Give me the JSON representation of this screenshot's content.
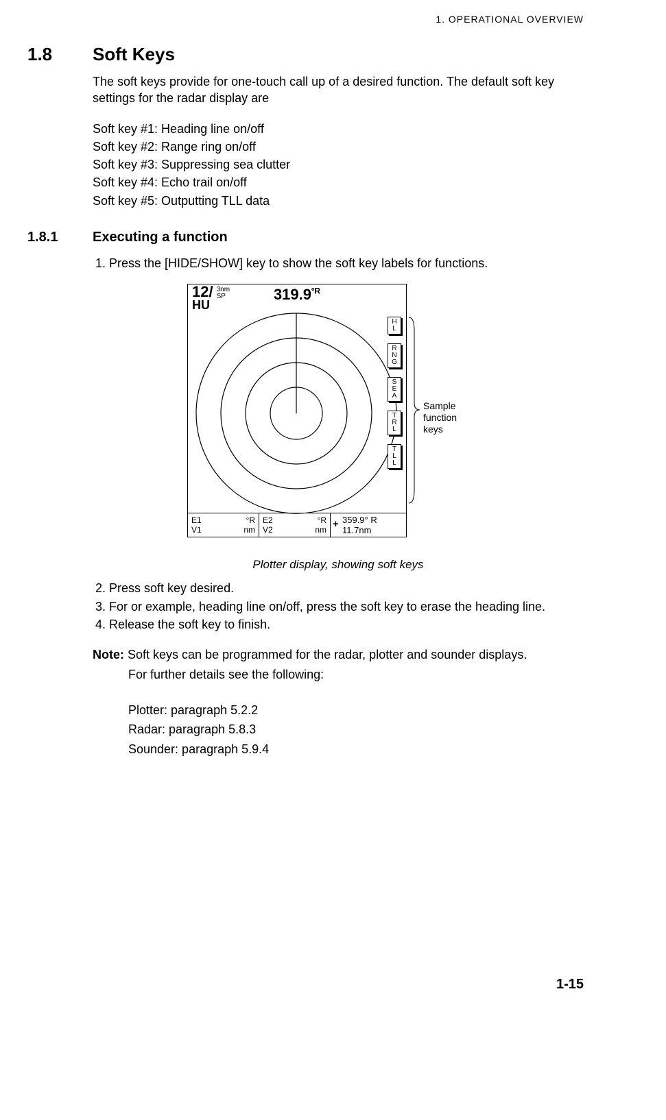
{
  "header": {
    "chapter": "1.   OPERATIONAL OVERVIEW"
  },
  "section": {
    "num": "1.8",
    "title": "Soft Keys"
  },
  "intro": "The soft keys provide for one-touch call up of a desired function. The default soft key settings for the radar display are",
  "softkey_defaults": [
    "Soft key #1: Heading line on/off",
    "Soft key #2: Range ring on/off",
    "Soft key #3: Suppressing sea clutter",
    "Soft key #4: Echo trail on/off",
    "Soft key #5: Outputting TLL data"
  ],
  "subsection": {
    "num": "1.8.1",
    "title": "Executing a function"
  },
  "steps_a": [
    "Press the [HIDE/SHOW] key to show the soft key labels for functions."
  ],
  "figure": {
    "range_main": "12",
    "range_sep": "/",
    "range_sub1": "3nm",
    "range_sub2": "SP",
    "hu": "HU",
    "bearing": "319.9",
    "bearing_unit": "ºR",
    "e1": "E1",
    "v1": "V1",
    "e1u": "°R",
    "v1u": "nm",
    "e2": "E2",
    "v2": "V2",
    "e2u": "°R",
    "v2u": "nm",
    "cursor_brg": "359.9°  R",
    "cursor_rng": "11.7nm",
    "keys": [
      "HL",
      "RNG",
      "SEA",
      "TRL",
      "TLL"
    ],
    "bracket_label1": "Sample function",
    "bracket_label2": "keys",
    "caption": "Plotter display, showing soft keys"
  },
  "steps_b": [
    "Press soft key desired.",
    "For or example, heading line on/off, press the soft key to erase the heading line.",
    "Release the soft key to finish."
  ],
  "note": {
    "label": "Note:",
    "line1": " Soft keys can be programmed for the radar, plotter and sounder displays. ",
    "line2": "For further details see the following:",
    "refs": [
      "Plotter: paragraph 5.2.2",
      "Radar: paragraph 5.8.3",
      "Sounder: paragraph 5.9.4"
    ]
  },
  "page": "1-15"
}
